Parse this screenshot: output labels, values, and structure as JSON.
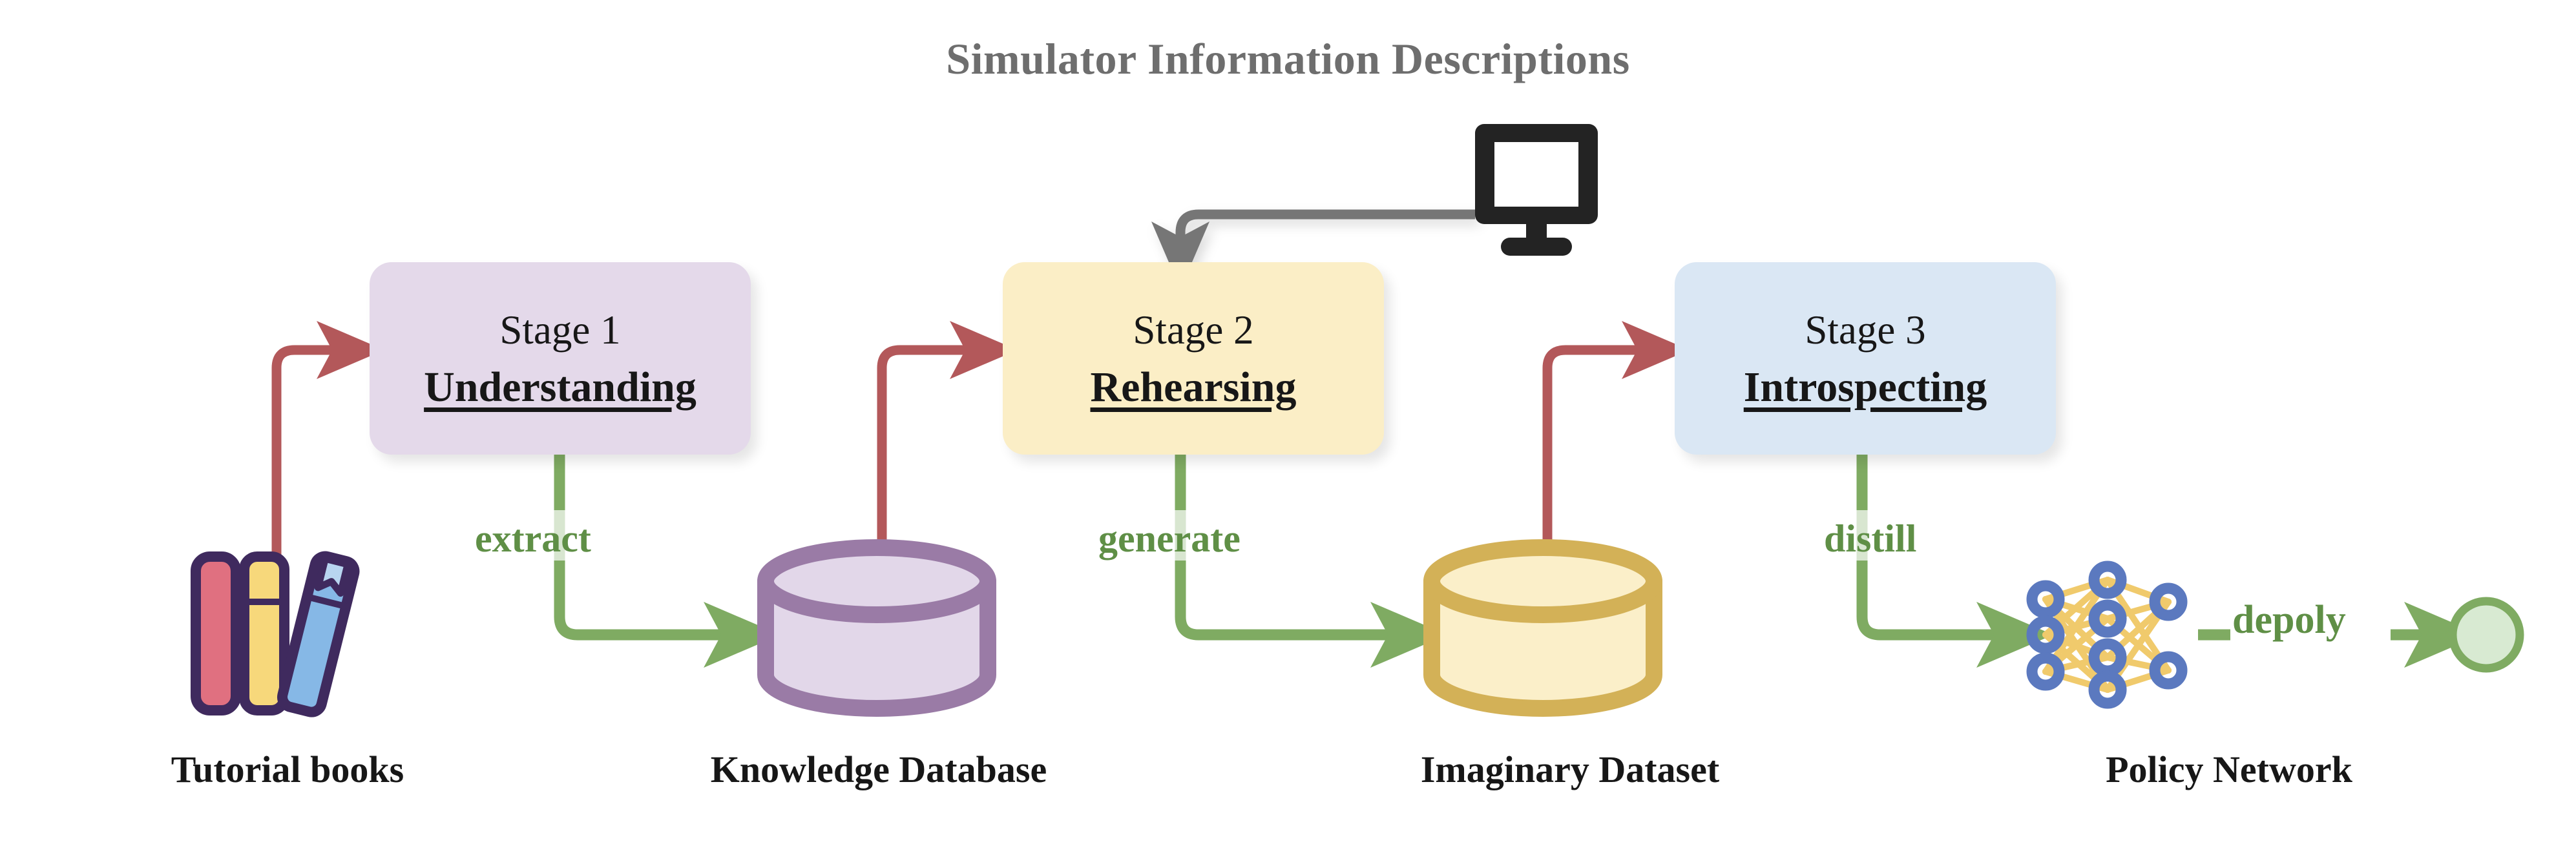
{
  "title": "Simulator Information Descriptions",
  "stages": [
    {
      "top_label": "Stage 1",
      "name": "Understanding",
      "color": "#e4d9ea"
    },
    {
      "top_label": "Stage 2",
      "name": "Rehearsing",
      "color": "#fbeec6"
    },
    {
      "top_label": "Stage 3",
      "name": "Introspecting",
      "color": "#dae7f4"
    }
  ],
  "edge_labels": {
    "extract": "extract",
    "generate": "generate",
    "distill": "distill",
    "deploy": "depoly"
  },
  "captions": {
    "books": "Tutorial books",
    "knowledge_database": "Knowledge Database",
    "imaginary_dataset": "Imaginary Dataset",
    "policy_network": "Policy Network"
  },
  "icons": {
    "books": "books-icon",
    "monitor": "monitor-icon",
    "knowledge_database": "database-cylinder-icon",
    "imaginary_dataset": "database-cylinder-icon",
    "policy_network": "neural-network-icon",
    "deployed_agent": "deployed-node-icon"
  },
  "colors": {
    "title_gray": "#6e6e6e",
    "red_arrow": "#b3585a",
    "green_arrow": "#7fab62",
    "gray_arrow": "#767676",
    "stage1_fill": "#e4d9ea",
    "stage2_fill": "#fbeec6",
    "stage3_fill": "#dae7f4",
    "purple_cylinder_stroke": "#9a7ba6",
    "purple_cylinder_fill": "#e2d7e9",
    "gold_cylinder_stroke": "#d3b157",
    "gold_cylinder_fill": "#fbefc9",
    "nn_node": "#5b79bf",
    "nn_edge": "#f0ca6c",
    "deploy_node_fill": "#d8ead2",
    "deploy_node_stroke": "#7fab62",
    "book_red": "#e07080",
    "book_yellow": "#f7d87b",
    "book_blue": "#86b8e6",
    "book_outline": "#3f2a5e",
    "monitor_black": "#232323",
    "label_green": "#5f8f46",
    "text_black": "#171717"
  },
  "flow": {
    "edges": [
      {
        "from": "books",
        "to": "stage-1",
        "color": "red"
      },
      {
        "from": "stage-1",
        "to": "knowledge-database",
        "color": "green",
        "label": "extract"
      },
      {
        "from": "knowledge-database",
        "to": "stage-2",
        "color": "red"
      },
      {
        "from": "monitor",
        "to": "stage-2",
        "color": "gray"
      },
      {
        "from": "stage-2",
        "to": "imaginary-dataset",
        "color": "green",
        "label": "generate"
      },
      {
        "from": "imaginary-dataset",
        "to": "stage-3",
        "color": "red"
      },
      {
        "from": "stage-3",
        "to": "policy-network",
        "color": "green",
        "label": "distill"
      },
      {
        "from": "policy-network",
        "to": "deployed-agent",
        "color": "green",
        "label": "depoly"
      }
    ]
  }
}
